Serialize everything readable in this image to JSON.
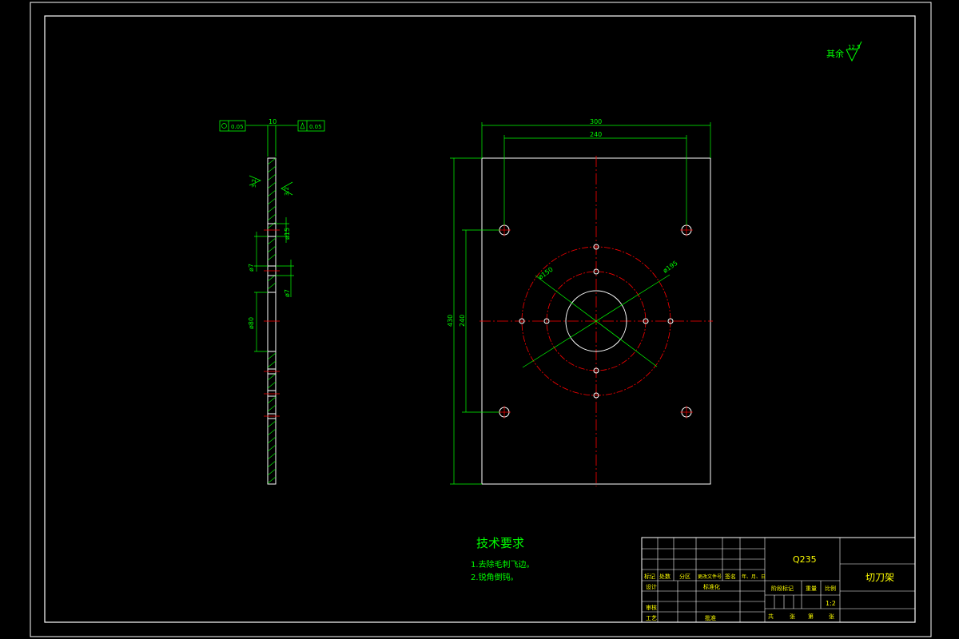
{
  "colors": {
    "background": "#000000",
    "outline": "#ffffff",
    "dimension": "#00ff00",
    "centerline": "#ff0000",
    "text": "#00ff00",
    "titleblock_text": "#ffff00"
  },
  "side_view": {
    "thickness": "10",
    "tolerance_left": "0.05",
    "tolerance_right": "0.05",
    "roughness_1": "3.2",
    "roughness_2": "3.2",
    "dim_d1": "ø7",
    "dim_d2": "ø7",
    "dim_d3": "ø15",
    "dim_d4": "ø80"
  },
  "front_view": {
    "width_total": "300",
    "width_holes": "240",
    "height_total": "430",
    "height_holes": "240",
    "dia_outer": "ø150",
    "dia_bolt": "ø195"
  },
  "roughness_note": {
    "label": "其余",
    "value": "12.5"
  },
  "tech_requirements": {
    "title": "技术要求",
    "items": [
      "1.去除毛刺飞边。",
      "2.锐角倒钝。"
    ]
  },
  "title_block": {
    "material": "Q235",
    "part_name": "切刀架",
    "scale": "1:2",
    "col_headers": [
      "标记",
      "处数",
      "分区",
      "更改文件号",
      "签名",
      "年、月、日"
    ],
    "design": "设计",
    "standard": "标准化",
    "review": "审核",
    "process": "工艺",
    "approve": "批准",
    "stage_mark": "阶段标记",
    "weight": "重量",
    "scale_label": "比例",
    "sheets_total": "共",
    "sheets_word": "张",
    "sheet_no": "第",
    "sheet_word": "张"
  }
}
